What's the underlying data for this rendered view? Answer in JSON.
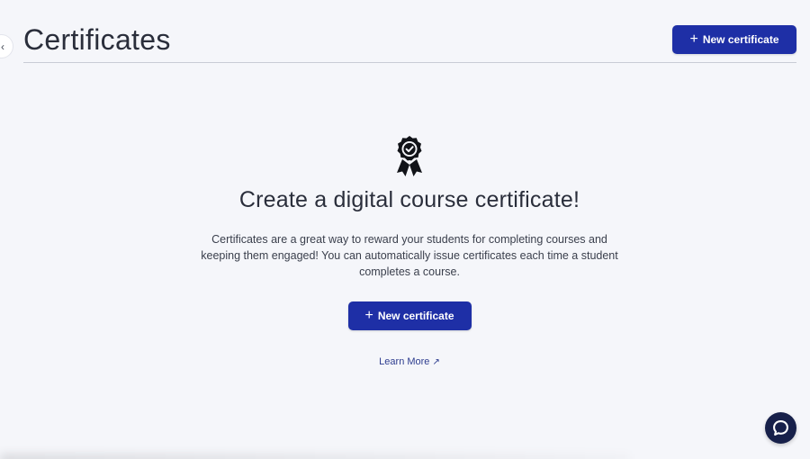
{
  "header": {
    "title": "Certificates",
    "new_button_label": "New certificate"
  },
  "empty_state": {
    "icon": "award-ribbon-icon",
    "title": "Create a digital course certificate!",
    "description": "Certificates are a great way to reward your students for completing courses and keeping them engaged! You can automatically issue certificates each time a student completes a course.",
    "button_label": "New certificate",
    "learn_more_label": "Learn More",
    "learn_more_arrow": "↗"
  },
  "controls": {
    "collapse_glyph": "‹",
    "plus_glyph": "+",
    "chat_icon": "chat-bubble-icon"
  },
  "colors": {
    "primary": "#1e2fa6",
    "background": "#f5f6fa",
    "chat_button": "#17204a",
    "link": "#2e3d8f"
  }
}
